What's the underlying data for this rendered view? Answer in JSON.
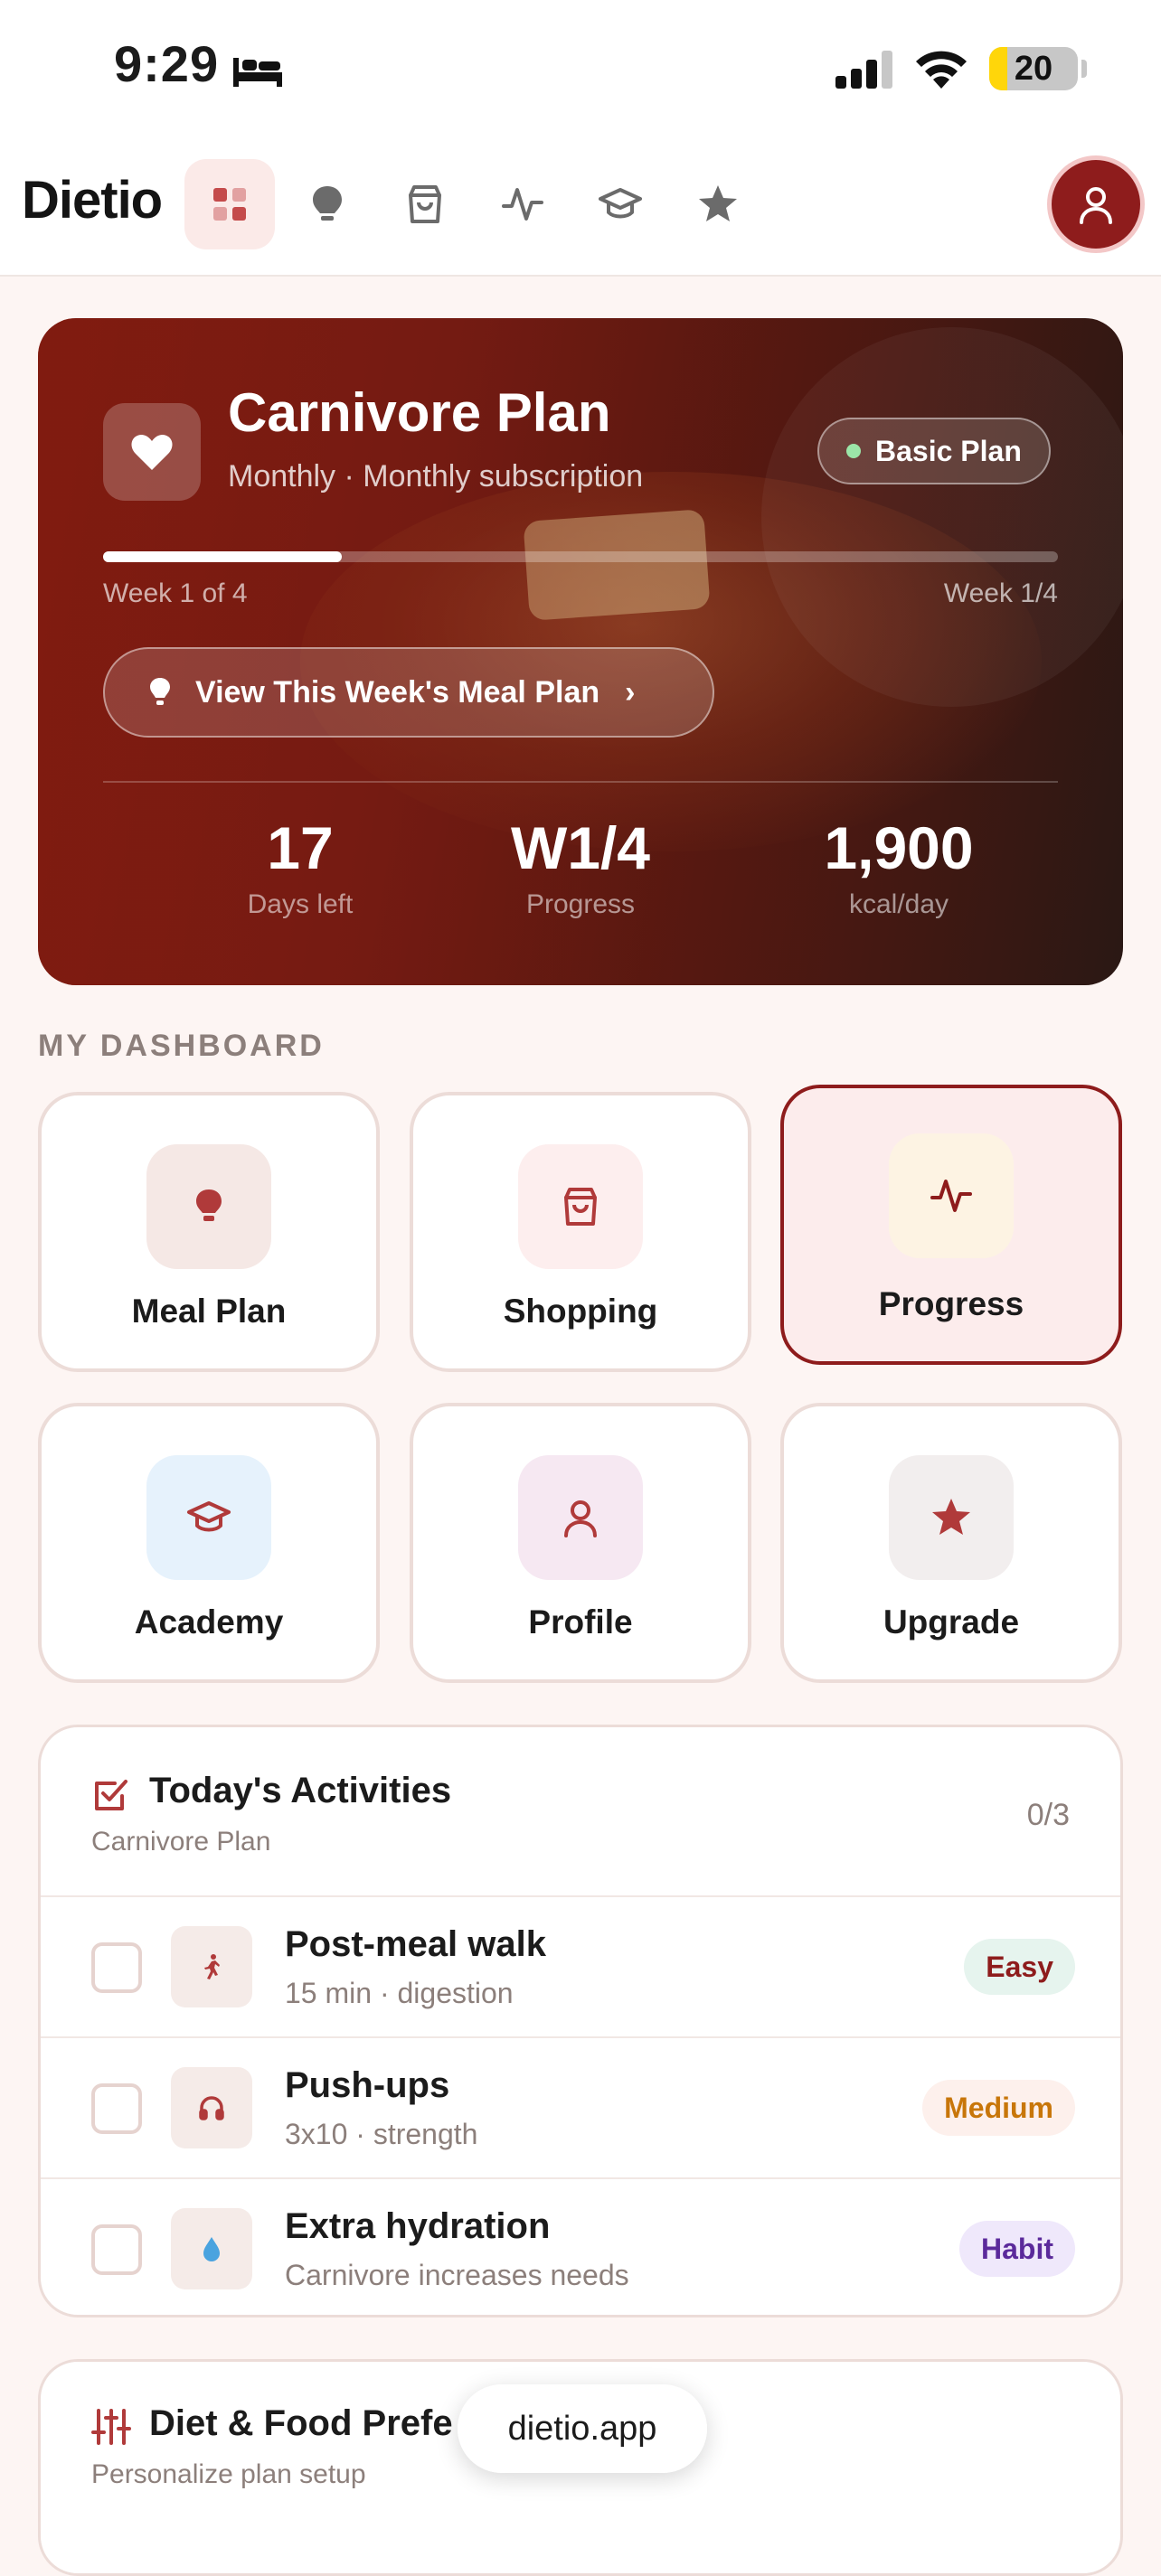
{
  "status_bar": {
    "time": "9:29",
    "battery_level": "20",
    "battery_fraction": 0.2,
    "icons": [
      "bed-icon",
      "cellular-signal-icon",
      "wifi-icon",
      "battery-icon"
    ]
  },
  "nav": {
    "brand": "Dietio",
    "items": [
      {
        "name": "dashboard",
        "icon": "grid-icon",
        "active": true
      },
      {
        "name": "meal-plan",
        "icon": "lightbulb-icon",
        "active": false
      },
      {
        "name": "shopping",
        "icon": "shopping-bag-icon",
        "active": false
      },
      {
        "name": "progress",
        "icon": "activity-icon",
        "active": false
      },
      {
        "name": "academy",
        "icon": "graduation-cap-icon",
        "active": false
      },
      {
        "name": "upgrade",
        "icon": "star-icon",
        "active": false
      }
    ],
    "profile_icon": "user-icon"
  },
  "hero": {
    "title": "Carnivore Plan",
    "subtitle": "Monthly · Monthly subscription",
    "badge": "Basic Plan",
    "progress_fraction": 0.25,
    "week_left": "Week 1 of 4",
    "week_right": "Week 1/4",
    "cta": "View This Week's Meal Plan",
    "stats": [
      {
        "value": "17",
        "label": "Days left"
      },
      {
        "value": "W1/4",
        "label": "Progress"
      },
      {
        "value": "1,900",
        "label": "kcal/day"
      }
    ]
  },
  "dashboard": {
    "label": "MY DASHBOARD",
    "tiles": [
      {
        "label": "Meal Plan",
        "icon": "lightbulb-icon",
        "bg": "#f5e8e5",
        "selected": false
      },
      {
        "label": "Shopping",
        "icon": "shopping-bag-icon",
        "bg": "#fdeeee",
        "selected": false
      },
      {
        "label": "Progress",
        "icon": "activity-icon",
        "bg": "#fdf3e3",
        "selected": true
      },
      {
        "label": "Academy",
        "icon": "graduation-cap-icon",
        "bg": "#e6f2fc",
        "selected": false
      },
      {
        "label": "Profile",
        "icon": "user-icon",
        "bg": "#f6e8f2",
        "selected": false
      },
      {
        "label": "Upgrade",
        "icon": "star-icon",
        "bg": "#f2eeee",
        "selected": false
      }
    ]
  },
  "activities": {
    "title": "Today's Activities",
    "subtitle": "Carnivore Plan",
    "count": "0/3",
    "items": [
      {
        "title": "Post-meal walk",
        "sub": "15 min · digestion",
        "tag": "Easy",
        "tag_bg": "#e6f4ee",
        "tag_color": "#8e1c1c",
        "icon": "walking-icon",
        "checked": false
      },
      {
        "title": "Push-ups",
        "sub": "3x10 · strength",
        "tag": "Medium",
        "tag_bg": "#fdf0ec",
        "tag_color": "#c8760a",
        "icon": "headphones-icon",
        "checked": false
      },
      {
        "title": "Extra hydration",
        "sub": "Carnivore increases needs",
        "tag": "Habit",
        "tag_bg": "#efe8fb",
        "tag_color": "#5b2a9b",
        "icon": "water-drop-icon",
        "checked": false
      }
    ]
  },
  "preferences": {
    "title": "Diet & Food Prefe",
    "subtitle": "Personalize plan setup",
    "icon": "sliders-icon"
  },
  "url_bar": {
    "text": "dietio.app"
  },
  "colors": {
    "accent": "#8e1c1c",
    "page_bg": "#fdf5f3",
    "tile_border": "#ecdcd8"
  }
}
